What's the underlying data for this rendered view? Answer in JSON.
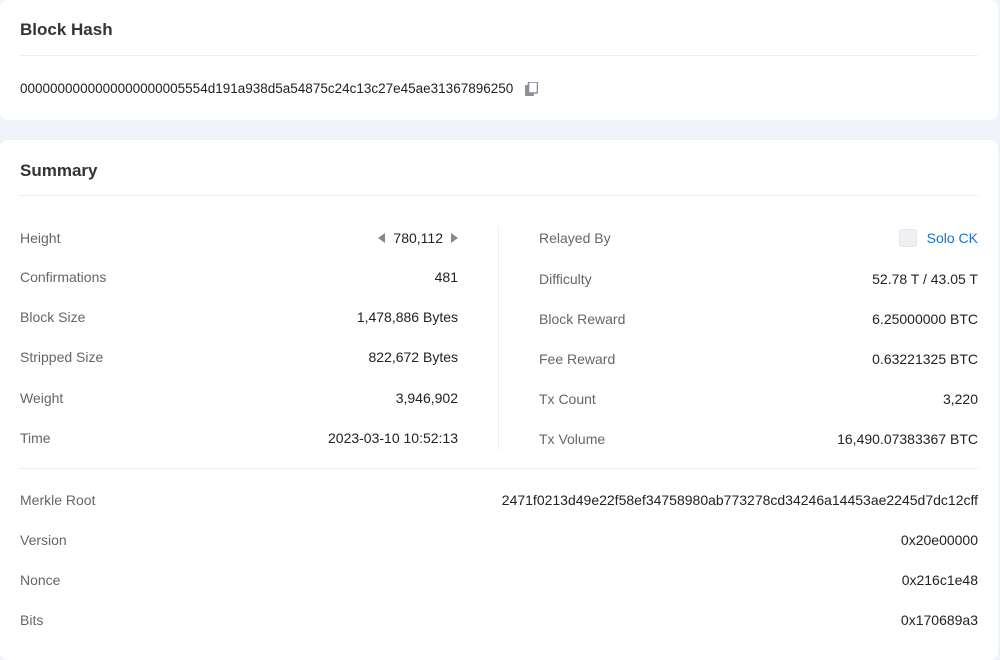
{
  "block_hash": {
    "title": "Block Hash",
    "value": "0000000000000000000005554d191a938d5a54875c24c13c27e45ae31367896250",
    "copy_icon": "copy-icon"
  },
  "summary": {
    "title": "Summary",
    "left": [
      {
        "label": "Height",
        "value": "780,112"
      },
      {
        "label": "Confirmations",
        "value": "481"
      },
      {
        "label": "Block Size",
        "value": "1,478,886 Bytes"
      },
      {
        "label": "Stripped Size",
        "value": "822,672 Bytes"
      },
      {
        "label": "Weight",
        "value": "3,946,902"
      },
      {
        "label": "Time",
        "value": "2023-03-10 10:52:13"
      }
    ],
    "right": [
      {
        "label": "Relayed By",
        "value": "Solo CK"
      },
      {
        "label": "Difficulty",
        "value": "52.78 T / 43.05 T"
      },
      {
        "label": "Block Reward",
        "value": "6.25000000 BTC"
      },
      {
        "label": "Fee Reward",
        "value": "0.63221325 BTC"
      },
      {
        "label": "Tx Count",
        "value": "3,220"
      },
      {
        "label": "Tx Volume",
        "value": "16,490.07383367 BTC"
      }
    ],
    "bottom": [
      {
        "label": "Merkle Root",
        "value": "2471f0213d49e22f58ef34758980ab773278cd34246a14453ae2245d7dc12cff"
      },
      {
        "label": "Version",
        "value": "0x20e00000"
      },
      {
        "label": "Nonce",
        "value": "0x216c1e48"
      },
      {
        "label": "Bits",
        "value": "0x170689a3"
      }
    ]
  },
  "colors": {
    "link": "#1a73c9",
    "label": "#666666",
    "value": "#222222",
    "background": "#f0f4fa"
  }
}
